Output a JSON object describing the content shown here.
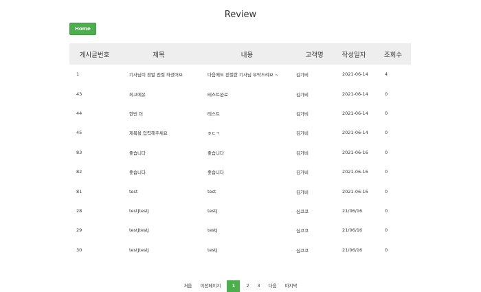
{
  "page": {
    "title": "Review"
  },
  "toolbar": {
    "home_label": "Home"
  },
  "table": {
    "headers": [
      "게시글번호",
      "제목",
      "내용",
      "고객명",
      "작성일자",
      "조회수"
    ],
    "rows": [
      {
        "id": "1",
        "title": "기사님이 정말 친절 하셨어요",
        "content": "다음에도 친절한 기사님 부탁드려요 ~",
        "customer": "김가비",
        "date": "2021-06-14",
        "views": "4"
      },
      {
        "id": "43",
        "title": "최고에유",
        "content": "테스트완료",
        "customer": "김가비",
        "date": "2021-06-14",
        "views": "0"
      },
      {
        "id": "44",
        "title": "한번 더",
        "content": "테스트",
        "customer": "김가비",
        "date": "2021-06-14",
        "views": "0"
      },
      {
        "id": "45",
        "title": "제목을 입력해주세요",
        "content": "ㅎㄷㄱ",
        "customer": "김가비",
        "date": "2021-06-14",
        "views": "0"
      },
      {
        "id": "83",
        "title": "좋습니다",
        "content": "좋습니다",
        "customer": "김가비",
        "date": "2021-06-16",
        "views": "0"
      },
      {
        "id": "82",
        "title": "좋습니다",
        "content": "좋습니다",
        "customer": "김가비",
        "date": "2021-06-16",
        "views": "0"
      },
      {
        "id": "81",
        "title": "test",
        "content": "test",
        "customer": "김가비",
        "date": "2021-06-16",
        "views": "0"
      },
      {
        "id": "28",
        "title": "testJtestJ",
        "content": "testJ",
        "customer": "심코코",
        "date": "21/06/16",
        "views": "0"
      },
      {
        "id": "29",
        "title": "testJtestJ",
        "content": "testJ",
        "customer": "심코코",
        "date": "21/06/16",
        "views": "0"
      },
      {
        "id": "30",
        "title": "testJtestJ",
        "content": "testJ",
        "customer": "심코코",
        "date": "21/06/16",
        "views": "0"
      }
    ]
  },
  "pagination": {
    "first": "처음",
    "prev": "이전페이지",
    "pages": [
      "1",
      "2",
      "3"
    ],
    "current": "1",
    "next": "다음",
    "last": "마지막"
  },
  "colors": {
    "accent": "#4cae4c",
    "header_bg": "#eeeeee"
  }
}
